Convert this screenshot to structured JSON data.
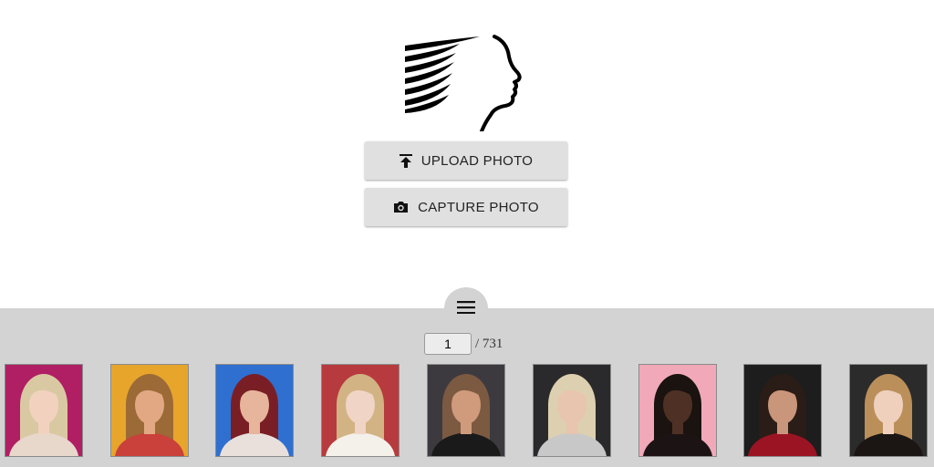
{
  "buttons": {
    "upload_label": "UPLOAD PHOTO",
    "capture_label": "CAPTURE PHOTO"
  },
  "pager": {
    "current_page": "1",
    "total_label": "/ 731"
  },
  "icons": {
    "logo": "face-profile-logo",
    "upload": "upload-icon",
    "capture": "camera-icon",
    "drawer_toggle": "hamburger-menu-icon"
  },
  "colors": {
    "drawer_bg": "#d3d3d3",
    "button_bg": "#e0e0e0"
  },
  "thumbnails": [
    {
      "bg": "#b01e63",
      "hair": "#d9c9a3",
      "skin": "#f2d2bf",
      "cloth": "#e8d7cb"
    },
    {
      "bg": "#e7a52c",
      "hair": "#9b6a36",
      "skin": "#e2a884",
      "cloth": "#c9413a"
    },
    {
      "bg": "#2f6fd0",
      "hair": "#7a1e25",
      "skin": "#e6b59c",
      "cloth": "#e9e0dc"
    },
    {
      "bg": "#b73a3e",
      "hair": "#d2b383",
      "skin": "#f0d4c5",
      "cloth": "#f4f0ea"
    },
    {
      "bg": "#3d3a3f",
      "hair": "#7b5a41",
      "skin": "#d09b7c",
      "cloth": "#1a1a1a"
    },
    {
      "bg": "#2a2a2d",
      "hair": "#ddd0b0",
      "skin": "#e7c5ae",
      "cloth": "#c8c8c8"
    },
    {
      "bg": "#f1a9b9",
      "hair": "#1a1310",
      "skin": "#4e3124",
      "cloth": "#1c1414"
    },
    {
      "bg": "#1c1d1c",
      "hair": "#2a1c16",
      "skin": "#c9957b",
      "cloth": "#9b1424"
    },
    {
      "bg": "#2b2b2b",
      "hair": "#bb8f5a",
      "skin": "#efd0bd",
      "cloth": "#1b1614"
    }
  ]
}
